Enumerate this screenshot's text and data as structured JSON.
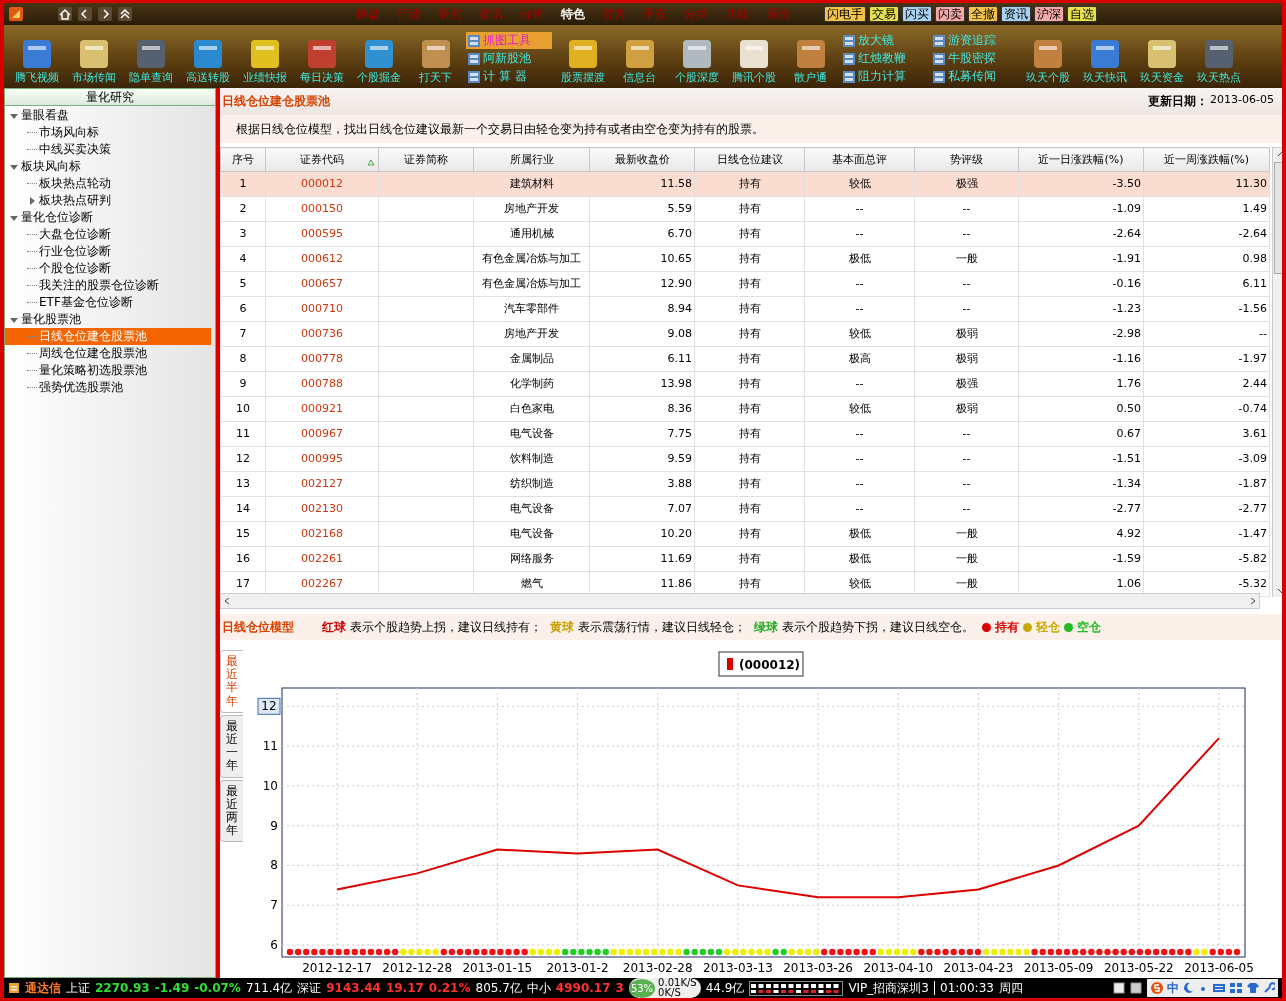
{
  "menu": [
    {
      "label": "操盘",
      "selected": false
    },
    {
      "label": "行情",
      "selected": false
    },
    {
      "label": "研究",
      "selected": false
    },
    {
      "label": "资讯",
      "selected": false
    },
    {
      "label": "分析",
      "selected": false
    },
    {
      "label": "特色",
      "selected": true
    },
    {
      "label": "官方",
      "selected": false
    },
    {
      "label": "平安",
      "selected": false
    },
    {
      "label": "分类",
      "selected": false
    },
    {
      "label": "功能",
      "selected": false
    },
    {
      "label": "系统",
      "selected": false
    }
  ],
  "quick_buttons": [
    {
      "label": "闪电手",
      "color": "#f2c24a"
    },
    {
      "label": "交易",
      "color": "#e6e04a"
    },
    {
      "label": "闪买",
      "color": "#a9d2f0"
    },
    {
      "label": "闪卖",
      "color": "#f4a8a8"
    },
    {
      "label": "全撤",
      "color": "#f2c24a"
    },
    {
      "label": "资讯",
      "color": "#a9d2f0"
    },
    {
      "label": "沪深",
      "color": "#f4a8a8"
    },
    {
      "label": "自选",
      "color": "#e6e04a"
    }
  ],
  "toolbar": [
    {
      "kind": "big",
      "label": "腾飞视频"
    },
    {
      "kind": "big",
      "label": "市场传闻"
    },
    {
      "kind": "big",
      "label": "隐单查询"
    },
    {
      "kind": "big",
      "label": "高送转股"
    },
    {
      "kind": "big",
      "label": "业绩快报"
    },
    {
      "kind": "big",
      "label": "每日决策"
    },
    {
      "kind": "big",
      "label": "个股掘金"
    },
    {
      "kind": "big",
      "label": "打天下"
    },
    {
      "kind": "stack",
      "items": [
        {
          "label": "抓图工具",
          "highlighted": true
        },
        {
          "label": "阿新股池",
          "highlighted": false
        },
        {
          "label": "计 算 器",
          "highlighted": false
        }
      ]
    },
    {
      "kind": "big",
      "label": "股票摆渡"
    },
    {
      "kind": "big",
      "label": "信息台"
    },
    {
      "kind": "big",
      "label": "个股深度"
    },
    {
      "kind": "big",
      "label": "腾讯个股"
    },
    {
      "kind": "big",
      "label": "散户通"
    },
    {
      "kind": "stack",
      "items": [
        {
          "label": "放大镜",
          "highlighted": false
        },
        {
          "label": "红烛教鞭",
          "highlighted": false
        },
        {
          "label": "阻力计算",
          "highlighted": false
        }
      ]
    },
    {
      "kind": "stack",
      "items": [
        {
          "label": "游资追踪",
          "highlighted": false
        },
        {
          "label": "牛股密探",
          "highlighted": false
        },
        {
          "label": "私募传闻",
          "highlighted": false
        }
      ]
    },
    {
      "kind": "big",
      "label": "玖天个股"
    },
    {
      "kind": "big",
      "label": "玖天快讯"
    },
    {
      "kind": "big",
      "label": "玖天资金"
    },
    {
      "kind": "big",
      "label": "玖天热点"
    }
  ],
  "sidebar": {
    "title": "量化研究",
    "items": [
      {
        "label": "量眼看盘",
        "expanded": true,
        "selected": false,
        "children": [
          {
            "label": "市场风向标",
            "selected": false
          },
          {
            "label": "中线买卖决策",
            "selected": false
          }
        ]
      },
      {
        "label": "板块风向标",
        "expanded": true,
        "selected": false,
        "children": [
          {
            "label": "板块热点轮动",
            "selected": false
          },
          {
            "label": "板块热点研判",
            "expanded": false,
            "selected": false
          }
        ]
      },
      {
        "label": "量化仓位诊断",
        "expanded": true,
        "selected": false,
        "children": [
          {
            "label": "大盘仓位诊断",
            "selected": false
          },
          {
            "label": "行业仓位诊断",
            "selected": false
          },
          {
            "label": "个股仓位诊断",
            "selected": false
          },
          {
            "label": "我关注的股票仓位诊断",
            "selected": false
          },
          {
            "label": "ETF基金仓位诊断",
            "selected": false
          }
        ]
      },
      {
        "label": "量化股票池",
        "expanded": true,
        "selected": false,
        "children": [
          {
            "label": "日线仓位建仓股票池",
            "selected": true
          },
          {
            "label": "周线仓位建仓股票池",
            "selected": false
          },
          {
            "label": "量化策略初选股票池",
            "selected": false
          },
          {
            "label": "强势优选股票池",
            "selected": false
          }
        ]
      }
    ]
  },
  "panel": {
    "title": "日线仓位建仓股票池",
    "update_label": "更新日期：",
    "update_date": "2013-06-05",
    "description": "根据日线仓位模型，找出日线仓位建议最新一个交易日由轻仓变为持有或者由空仓变为持有的股票。"
  },
  "table": {
    "columns": [
      "序号",
      "证券代码",
      "证券简称",
      "所属行业",
      "最新收盘价",
      "日线仓位建议",
      "基本面总评",
      "势评级",
      "近一日涨跌幅(%)",
      "近一周涨跌幅(%)"
    ],
    "rows": [
      {
        "selected": true,
        "cells": [
          "1",
          "000012",
          "",
          "建筑材料",
          "11.58",
          "持有",
          "较低",
          "极强",
          "-3.50",
          "11.30"
        ]
      },
      {
        "selected": false,
        "cells": [
          "2",
          "000150",
          "",
          "房地产开发",
          "5.59",
          "持有",
          "--",
          "--",
          "-1.09",
          "1.49"
        ]
      },
      {
        "selected": false,
        "cells": [
          "3",
          "000595",
          "",
          "通用机械",
          "6.70",
          "持有",
          "--",
          "--",
          "-2.64",
          "-2.64"
        ]
      },
      {
        "selected": false,
        "cells": [
          "4",
          "000612",
          "",
          "有色金属冶炼与加工",
          "10.65",
          "持有",
          "极低",
          "一般",
          "-1.91",
          "0.98"
        ]
      },
      {
        "selected": false,
        "cells": [
          "5",
          "000657",
          "",
          "有色金属冶炼与加工",
          "12.90",
          "持有",
          "--",
          "--",
          "-0.16",
          "6.11"
        ]
      },
      {
        "selected": false,
        "cells": [
          "6",
          "000710",
          "",
          "汽车零部件",
          "8.94",
          "持有",
          "--",
          "--",
          "-1.23",
          "-1.56"
        ]
      },
      {
        "selected": false,
        "cells": [
          "7",
          "000736",
          "",
          "房地产开发",
          "9.08",
          "持有",
          "较低",
          "极弱",
          "-2.98",
          "--"
        ]
      },
      {
        "selected": false,
        "cells": [
          "8",
          "000778",
          "",
          "金属制品",
          "6.11",
          "持有",
          "极高",
          "极弱",
          "-1.16",
          "-1.97"
        ]
      },
      {
        "selected": false,
        "cells": [
          "9",
          "000788",
          "",
          "化学制药",
          "13.98",
          "持有",
          "--",
          "极强",
          "1.76",
          "2.44"
        ]
      },
      {
        "selected": false,
        "cells": [
          "10",
          "000921",
          "",
          "白色家电",
          "8.36",
          "持有",
          "较低",
          "极弱",
          "0.50",
          "-0.74"
        ]
      },
      {
        "selected": false,
        "cells": [
          "11",
          "000967",
          "",
          "电气设备",
          "7.75",
          "持有",
          "--",
          "--",
          "0.67",
          "3.61"
        ]
      },
      {
        "selected": false,
        "cells": [
          "12",
          "000995",
          "",
          "饮料制造",
          "9.59",
          "持有",
          "--",
          "--",
          "-1.51",
          "-3.09"
        ]
      },
      {
        "selected": false,
        "cells": [
          "13",
          "002127",
          "",
          "纺织制造",
          "3.88",
          "持有",
          "--",
          "--",
          "-1.34",
          "-1.87"
        ]
      },
      {
        "selected": false,
        "cells": [
          "14",
          "002130",
          "",
          "电气设备",
          "7.07",
          "持有",
          "--",
          "--",
          "-2.77",
          "-2.77"
        ]
      },
      {
        "selected": false,
        "cells": [
          "15",
          "002168",
          "",
          "电气设备",
          "10.20",
          "持有",
          "极低",
          "一般",
          "4.92",
          "-1.47"
        ]
      },
      {
        "selected": false,
        "cells": [
          "16",
          "002261",
          "",
          "网络服务",
          "11.69",
          "持有",
          "极低",
          "一般",
          "-1.59",
          "-5.82"
        ]
      },
      {
        "selected": false,
        "cells": [
          "17",
          "002267",
          "",
          "燃气",
          "11.86",
          "持有",
          "较低",
          "一般",
          "1.06",
          "-5.32"
        ]
      }
    ]
  },
  "model": {
    "title": "日线仓位模型",
    "legend": [
      {
        "ball": "红球",
        "color": "#cc0000",
        "text": "表示个股趋势上拐，建议日线持有；"
      },
      {
        "ball": "黄球",
        "color": "#c8a000",
        "text": "表示震荡行情，建议日线轻仓；"
      },
      {
        "ball": "绿球",
        "color": "#22aa22",
        "text": "表示个股趋势下拐，建议日线空仓。"
      }
    ],
    "keys": [
      {
        "label": "持有",
        "color": "#dd0000"
      },
      {
        "label": "轻仓",
        "color": "#c8a800"
      },
      {
        "label": "空仓",
        "color": "#22bb22"
      }
    ]
  },
  "chart_tabs": [
    {
      "label": "最近半年",
      "selected": true
    },
    {
      "label": "最近一年",
      "selected": false
    },
    {
      "label": "最近两年",
      "selected": false
    }
  ],
  "chart_data": {
    "type": "line",
    "series": [
      {
        "name": "(000012)",
        "color": "#dd0000",
        "values": [
          7.4,
          7.8,
          8.4,
          8.3,
          8.4,
          7.5,
          7.2,
          7.2,
          7.4,
          8.0,
          9.0,
          11.2
        ]
      }
    ],
    "categories": [
      "2012-12-17",
      "2012-12-28",
      "2013-01-15",
      "2013-01-2",
      "2013-02-28",
      "2013-03-13",
      "2013-03-26",
      "2013-04-10",
      "2013-04-23",
      "2013-05-09",
      "2013-05-22",
      "2013-06-05"
    ],
    "yticks": [
      6,
      7,
      8,
      9,
      10,
      11,
      {
        "value": 12,
        "label": "12"
      }
    ],
    "ylim": [
      5.7,
      12.46
    ],
    "grid": true
  },
  "signal_dots": [
    {
      "color": "#ee1111"
    },
    {
      "color": "#ee1111"
    },
    {
      "color": "#ee1111"
    },
    {
      "color": "#ee1111"
    },
    {
      "color": "#ee1111"
    },
    {
      "color": "#ee1111"
    },
    {
      "color": "#ee1111"
    },
    {
      "color": "#ee1111"
    },
    {
      "color": "#ee1111"
    },
    {
      "color": "#ee1111"
    },
    {
      "color": "#ee1111"
    },
    {
      "color": "#ee1111"
    },
    {
      "color": "#ee1111"
    },
    {
      "color": "#ee1111"
    },
    {
      "color": "#eeee00"
    },
    {
      "color": "#eeee00"
    },
    {
      "color": "#eeee00"
    },
    {
      "color": "#eeee00"
    },
    {
      "color": "#eeee00"
    },
    {
      "color": "#ee1111"
    },
    {
      "color": "#ee1111"
    },
    {
      "color": "#ee1111"
    },
    {
      "color": "#ee1111"
    },
    {
      "color": "#ee1111"
    },
    {
      "color": "#ee1111"
    },
    {
      "color": "#ee1111"
    },
    {
      "color": "#ee1111"
    },
    {
      "color": "#ee1111"
    },
    {
      "color": "#ee1111"
    },
    {
      "color": "#ee1111"
    },
    {
      "color": "#eeee00"
    },
    {
      "color": "#eeee00"
    },
    {
      "color": "#eeee00"
    },
    {
      "color": "#eeee00"
    },
    {
      "color": "#22cc22"
    },
    {
      "color": "#22cc22"
    },
    {
      "color": "#22cc22"
    },
    {
      "color": "#22cc22"
    },
    {
      "color": "#22cc22"
    },
    {
      "color": "#22cc22"
    },
    {
      "color": "#eeee00"
    },
    {
      "color": "#eeee00"
    },
    {
      "color": "#eeee00"
    },
    {
      "color": "#eeee00"
    },
    {
      "color": "#eeee00"
    },
    {
      "color": "#eeee00"
    },
    {
      "color": "#eeee00"
    },
    {
      "color": "#eeee00"
    },
    {
      "color": "#eeee00"
    },
    {
      "color": "#22cc22"
    },
    {
      "color": "#22cc22"
    },
    {
      "color": "#22cc22"
    },
    {
      "color": "#22cc22"
    },
    {
      "color": "#22cc22"
    },
    {
      "color": "#eeee00"
    },
    {
      "color": "#eeee00"
    },
    {
      "color": "#eeee00"
    },
    {
      "color": "#eeee00"
    },
    {
      "color": "#eeee00"
    },
    {
      "color": "#eeee00"
    },
    {
      "color": "#22cc22"
    },
    {
      "color": "#22cc22"
    },
    {
      "color": "#eeee00"
    },
    {
      "color": "#eeee00"
    },
    {
      "color": "#eeee00"
    },
    {
      "color": "#eeee00"
    },
    {
      "color": "#ee1111"
    },
    {
      "color": "#ee1111"
    },
    {
      "color": "#ee1111"
    },
    {
      "color": "#ee1111"
    },
    {
      "color": "#ee1111"
    },
    {
      "color": "#ee1111"
    },
    {
      "color": "#ee1111"
    },
    {
      "color": "#eeee00"
    },
    {
      "color": "#eeee00"
    },
    {
      "color": "#eeee00"
    },
    {
      "color": "#eeee00"
    },
    {
      "color": "#eeee00"
    },
    {
      "color": "#ee1111"
    },
    {
      "color": "#ee1111"
    },
    {
      "color": "#ee1111"
    },
    {
      "color": "#ee1111"
    },
    {
      "color": "#ee1111"
    },
    {
      "color": "#ee1111"
    },
    {
      "color": "#ee1111"
    },
    {
      "color": "#ee1111"
    },
    {
      "color": "#eeee00"
    },
    {
      "color": "#eeee00"
    },
    {
      "color": "#eeee00"
    },
    {
      "color": "#eeee00"
    },
    {
      "color": "#eeee00"
    },
    {
      "color": "#eeee00"
    },
    {
      "color": "#ee1111"
    },
    {
      "color": "#ee1111"
    },
    {
      "color": "#ee1111"
    },
    {
      "color": "#ee1111"
    },
    {
      "color": "#ee1111"
    },
    {
      "color": "#ee1111"
    },
    {
      "color": "#ee1111"
    },
    {
      "color": "#ee1111"
    },
    {
      "color": "#ee1111"
    },
    {
      "color": "#ee1111"
    },
    {
      "color": "#ee1111"
    },
    {
      "color": "#ee1111"
    },
    {
      "color": "#ee1111"
    },
    {
      "color": "#ee1111"
    },
    {
      "color": "#ee1111"
    },
    {
      "color": "#ee1111"
    },
    {
      "color": "#ee1111"
    },
    {
      "color": "#ee1111"
    },
    {
      "color": "#ee1111"
    },
    {
      "color": "#ee1111"
    },
    {
      "color": "#eeee00"
    },
    {
      "color": "#eeee00"
    },
    {
      "color": "#ee1111"
    },
    {
      "color": "#ee1111"
    },
    {
      "color": "#ee1111"
    },
    {
      "color": "#ee1111"
    }
  ],
  "status_bar": {
    "brand": "通达信",
    "indices": [
      {
        "name": "上证",
        "value": "2270.93",
        "change": "-1.49",
        "pct": "-0.07%",
        "amount": "711.4亿",
        "color": "#30e030"
      },
      {
        "name": "深证",
        "value": "9143.44",
        "change": "19.17",
        "pct": "0.21%",
        "amount": "805.7亿",
        "color": "#ff3030"
      },
      {
        "name": "中小",
        "value": "4990.17",
        "change": "3",
        "color": "#ff3030"
      }
    ],
    "net": {
      "percent": "53%",
      "up": "0.01K/S",
      "down": "0K/S"
    },
    "amount_tail": "44.9亿",
    "account": "VIP_招商深圳3",
    "time": "01:00:33",
    "weekday": "周四",
    "ime": "中"
  }
}
